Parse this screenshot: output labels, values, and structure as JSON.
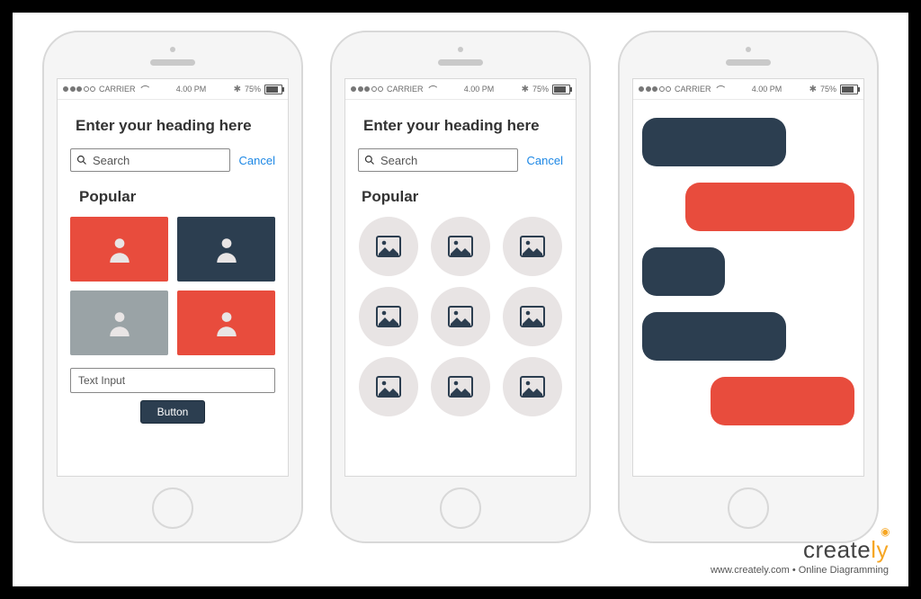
{
  "status_bar": {
    "carrier": "CARRIER",
    "time": "4.00 PM",
    "battery_pct": "75%"
  },
  "phone1": {
    "heading": "Enter your heading here",
    "search_placeholder": "Search",
    "cancel": "Cancel",
    "section": "Popular",
    "tiles": [
      {
        "color": "orange",
        "icon": "user"
      },
      {
        "color": "navy",
        "icon": "user"
      },
      {
        "color": "gray",
        "icon": "user"
      },
      {
        "color": "orange",
        "icon": "user"
      }
    ],
    "text_input_placeholder": "Text Input",
    "button_label": "Button"
  },
  "phone2": {
    "heading": "Enter your heading here",
    "search_placeholder": "Search",
    "cancel": "Cancel",
    "section": "Popular",
    "circle_count": 9
  },
  "phone3": {
    "bubbles": [
      {
        "side": "left",
        "color": "navy",
        "size": "med"
      },
      {
        "side": "right",
        "color": "orange",
        "size": "large"
      },
      {
        "side": "left",
        "color": "navy",
        "size": "small"
      },
      {
        "side": "left",
        "color": "navy",
        "size": "med"
      },
      {
        "side": "right",
        "color": "orange",
        "size": "med"
      }
    ]
  },
  "brand": {
    "name_a": "create",
    "name_b": "ly",
    "tagline": "www.creately.com • Online Diagramming"
  }
}
